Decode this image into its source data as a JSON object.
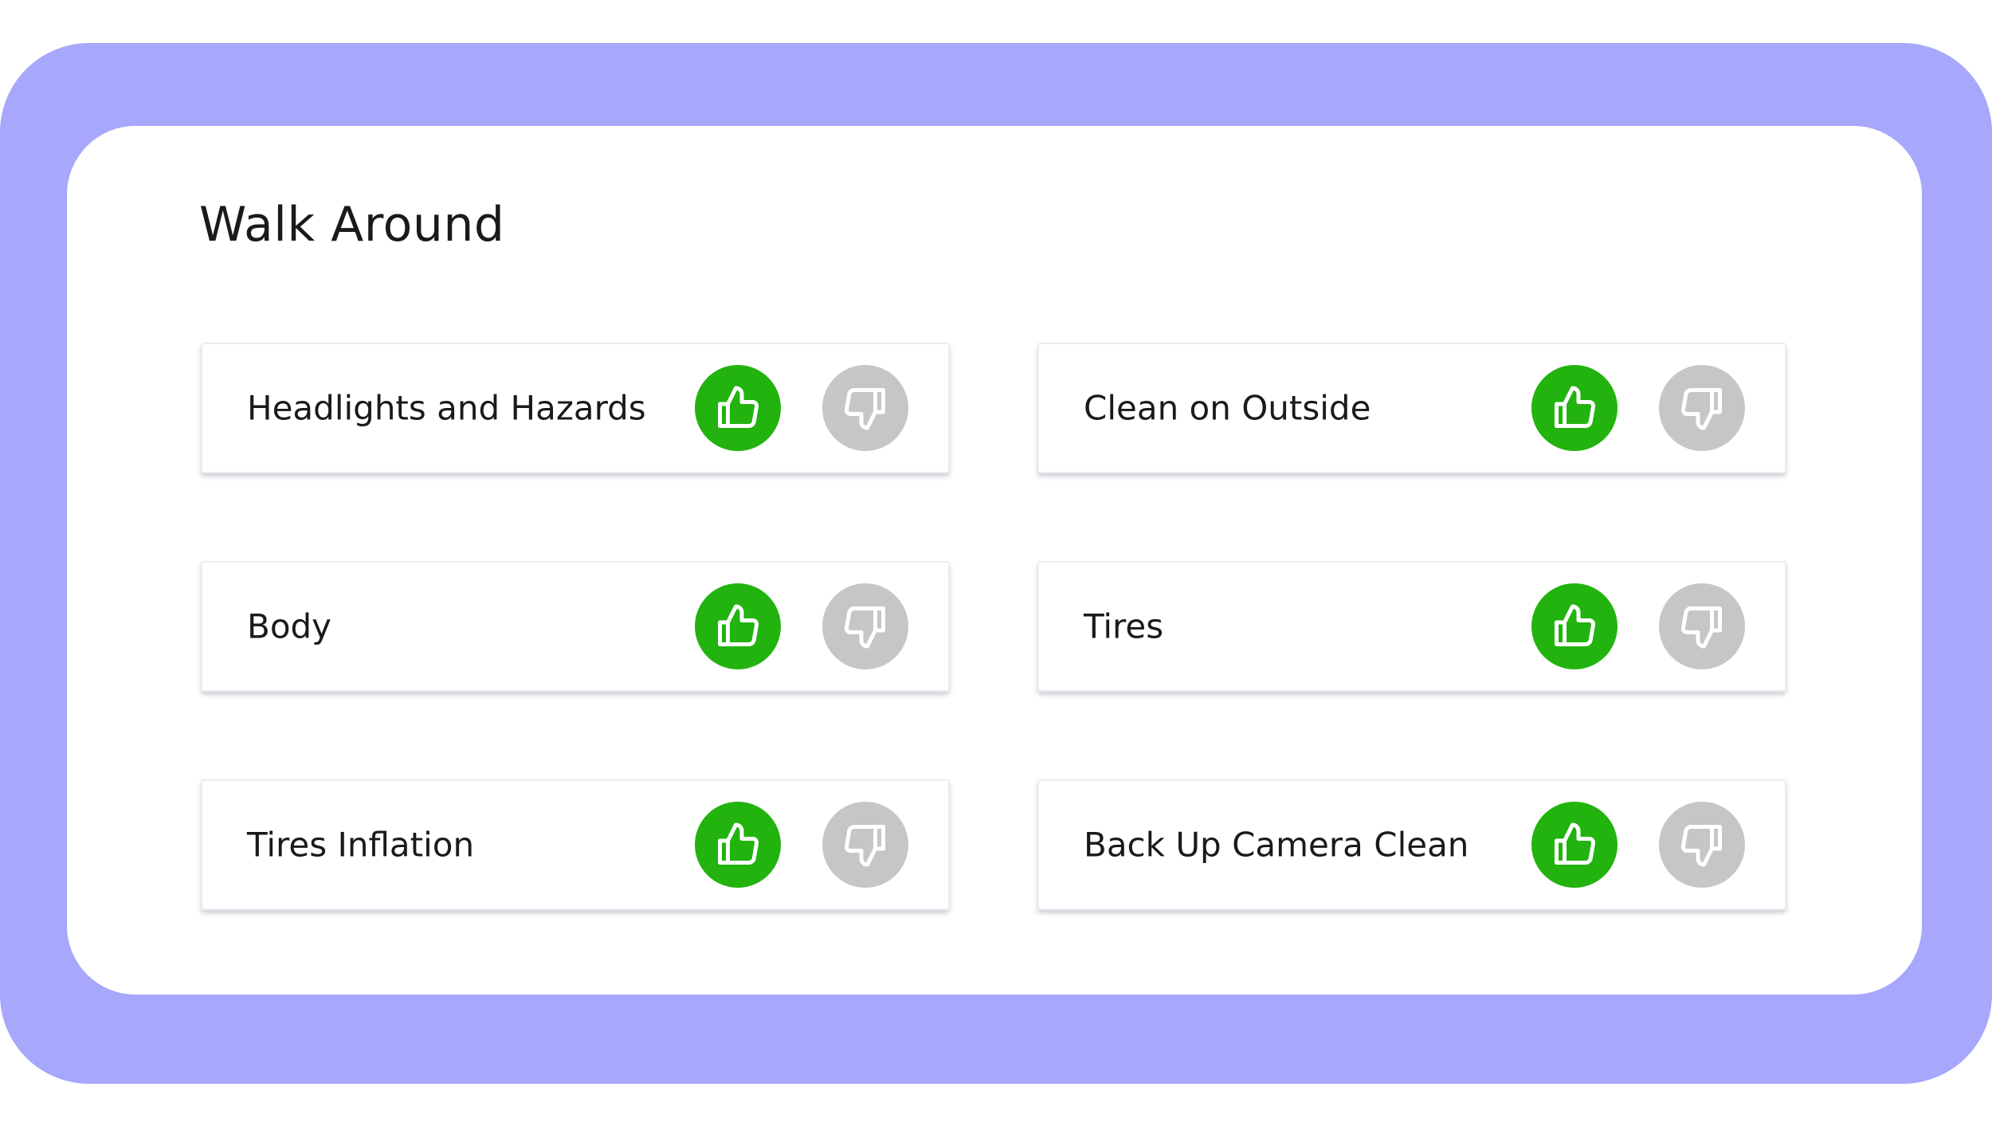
{
  "section": {
    "title": "Walk Around"
  },
  "items": [
    {
      "label": "Headlights and Hazards"
    },
    {
      "label": "Clean on Outside"
    },
    {
      "label": "Body"
    },
    {
      "label": "Tires"
    },
    {
      "label": "Tires Inflation"
    },
    {
      "label": "Back Up Camera Clean"
    }
  ],
  "icons": {
    "approve": "thumbs-up-icon",
    "reject": "thumbs-down-icon"
  },
  "colors": {
    "frame": "#a7a7fc",
    "card": "#ffffff",
    "approve_active": "#22b30f",
    "reject_inactive": "#c6c6c6",
    "icon": "#ffffff",
    "text": "#1a1a1a"
  }
}
